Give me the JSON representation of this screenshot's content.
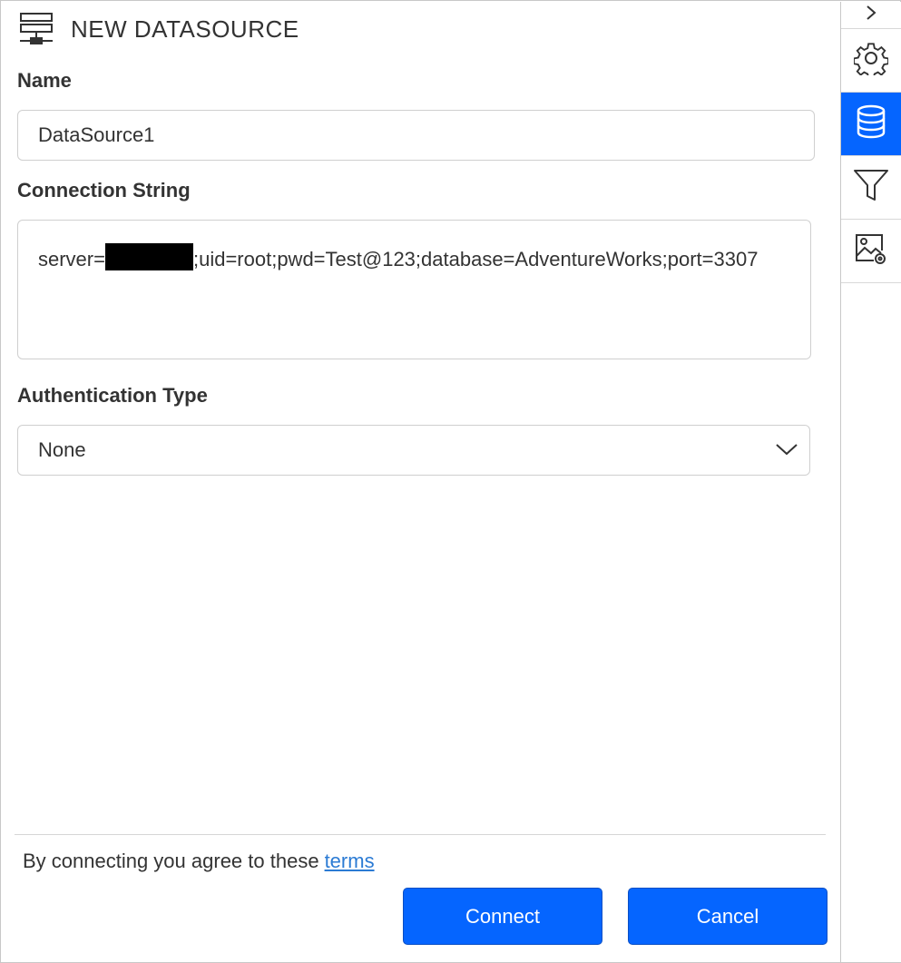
{
  "header": {
    "title": "NEW DATASOURCE",
    "icon": "server-icon"
  },
  "name_field": {
    "label": "Name",
    "value": "DataSource1"
  },
  "connection_string": {
    "label": "Connection String",
    "prefix": "server=",
    "suffix": ";uid=root;pwd=Test@123;database=AdventureWorks;port=3307"
  },
  "authentication": {
    "label": "Authentication Type",
    "selected": "None"
  },
  "footer": {
    "terms_text": "By connecting you agree to these",
    "terms_link": "terms",
    "connect_label": "Connect",
    "cancel_label": "Cancel"
  },
  "sidebar": {
    "items": [
      {
        "icon": "chevron-right-icon"
      },
      {
        "icon": "gear-icon"
      },
      {
        "icon": "database-icon",
        "active": true
      },
      {
        "icon": "filter-icon"
      },
      {
        "icon": "image-settings-icon"
      }
    ]
  },
  "colors": {
    "accent": "#0565ff",
    "link": "#2b7bd4",
    "border": "#cfcfcf"
  }
}
